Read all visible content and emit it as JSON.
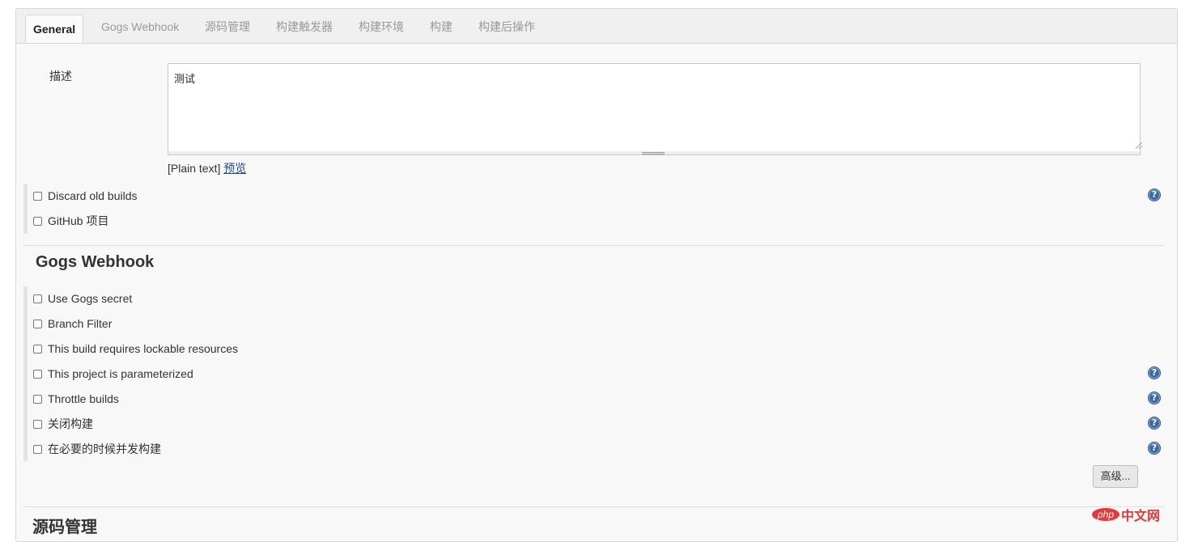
{
  "tabs": [
    {
      "label": "General",
      "active": true
    },
    {
      "label": "Gogs Webhook"
    },
    {
      "label": "源码管理"
    },
    {
      "label": "构建触发器"
    },
    {
      "label": "构建环境"
    },
    {
      "label": "构建"
    },
    {
      "label": "构建后操作"
    }
  ],
  "general": {
    "description_label": "描述",
    "description_value": "测试",
    "plain_text": "[Plain text]",
    "preview_link": "预览",
    "options": [
      {
        "label": "Discard old builds",
        "help": true
      },
      {
        "label": "GitHub 项目",
        "help": false
      }
    ]
  },
  "gogs": {
    "title": "Gogs Webhook",
    "options": [
      {
        "label": "Use Gogs secret",
        "help": false
      },
      {
        "label": "Branch Filter",
        "help": false
      },
      {
        "label": "This build requires lockable resources",
        "help": false
      },
      {
        "label": "This project is parameterized",
        "help": true
      },
      {
        "label": "Throttle builds",
        "help": true
      },
      {
        "label": "关闭构建",
        "help": true
      },
      {
        "label": "在必要的时候并发构建",
        "help": true
      }
    ],
    "advanced_button": "高级..."
  },
  "scm": {
    "title": "源码管理"
  },
  "help_glyph": "?",
  "watermark": {
    "logo": "php",
    "text": "中文网"
  },
  "colors": {
    "link": "#204a87",
    "help": "#3a6aa5",
    "watermark": "#e7373a"
  }
}
